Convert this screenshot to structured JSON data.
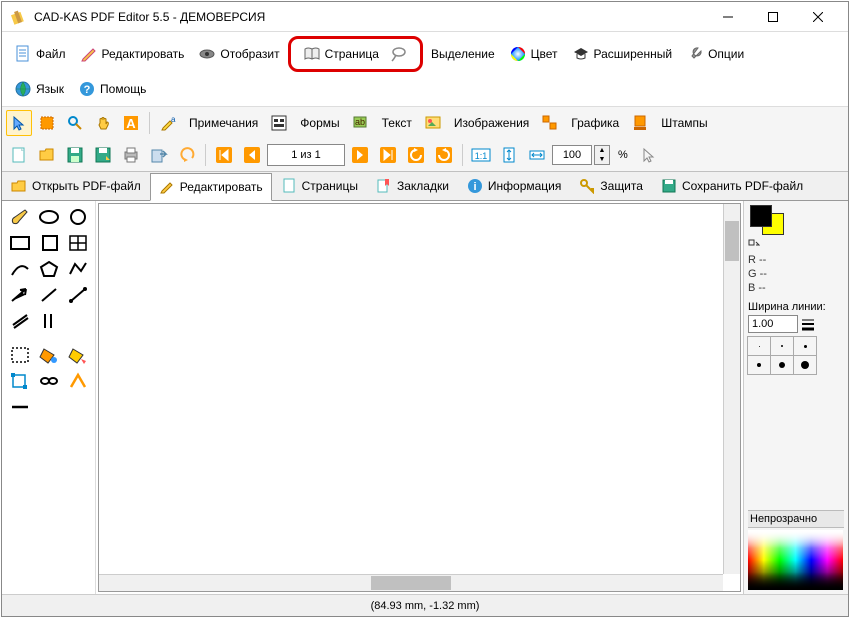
{
  "title": "CAD-KAS PDF Editor 5.5 - ДЕМОВЕРСИЯ",
  "menu": {
    "file": "Файл",
    "edit": "Редактировать",
    "show": "Отобразит",
    "page": "Страница",
    "select": "Выделение",
    "color": "Цвет",
    "advanced": "Расширенный",
    "options": "Опции",
    "lang": "Язык",
    "help": "Помощь"
  },
  "toolbar1": {
    "notes": "Примечания",
    "forms": "Формы",
    "text": "Текст",
    "images": "Изображения",
    "graphics": "Графика",
    "stamps": "Штампы"
  },
  "pager": {
    "text": "1 из 1"
  },
  "zoom": {
    "value": "100",
    "suffix": "%"
  },
  "tabs": {
    "open": "Открыть PDF-файл",
    "edit": "Редактировать",
    "pages": "Страницы",
    "bookmarks": "Закладки",
    "info": "Информация",
    "protect": "Защита",
    "save": "Сохранить PDF-файл"
  },
  "panel": {
    "r": "R --",
    "g": "G --",
    "b": "B --",
    "lineWidthLabel": "Ширина линии:",
    "lineWidthValue": "1.00",
    "opacity": "Непрозрачно"
  },
  "status": "(84.93 mm, -1.32 mm)"
}
